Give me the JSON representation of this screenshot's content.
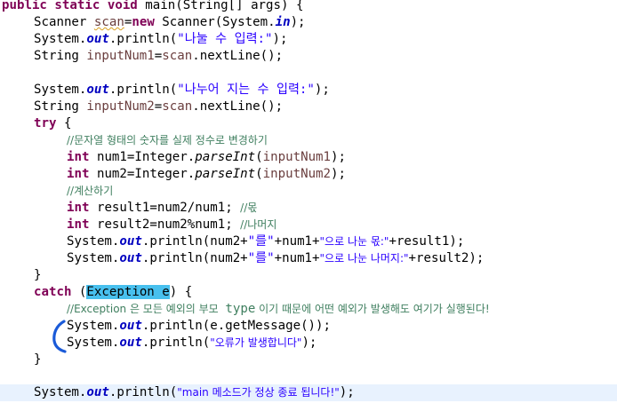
{
  "editor": {
    "l1": {
      "kw1": "public",
      "kw2": "static",
      "kw3": "void",
      "rest": " main(String[] args) {"
    },
    "l2": {
      "a": "Scanner ",
      "scan": "scan",
      "b": "=",
      "kw": "new",
      "c": " Scanner(System.",
      "in": "in",
      "d": ");"
    },
    "l3": {
      "a": "System.",
      "out": "out",
      "b": ".println(",
      "s": "\"나눌 수 입력:\"",
      "c": ");"
    },
    "l4": {
      "a": "String ",
      "v": "inputNum1",
      "b": "=",
      "scan": "scan",
      "c": ".nextLine();"
    },
    "l6": {
      "a": "System.",
      "out": "out",
      "b": ".println(",
      "s": "\"나누어 지는 수 입력:\"",
      "c": ");"
    },
    "l7": {
      "a": "String ",
      "v": "inputNum2",
      "b": "=",
      "scan": "scan",
      "c": ".nextLine();"
    },
    "l8": {
      "kw": "try",
      "b": " {"
    },
    "l9": {
      "cm": "//문자열 형태의 숫자를 실제 정수로 변경하기"
    },
    "l10": {
      "kw": "int",
      "a": " num1=Integer.",
      "m": "parseInt",
      "b": "(",
      "v": "inputNum1",
      "c": ");"
    },
    "l11": {
      "kw": "int",
      "a": " num2=Integer.",
      "m": "parseInt",
      "b": "(",
      "v": "inputNum2",
      "c": ");"
    },
    "l12": {
      "cm": "//계산하기"
    },
    "l13": {
      "kw": "int",
      "a": " result1=num2/num1; ",
      "cm": "//몫"
    },
    "l14": {
      "kw": "int",
      "a": " result2=num2%num1; ",
      "cm": "//나머지"
    },
    "l15": {
      "a": "System.",
      "out": "out",
      "b": ".println(num2+",
      "s1": "\"를\"",
      "c": "+num1+",
      "s2": "\"으로 나눈 몫:\"",
      "d": "+result1);"
    },
    "l16": {
      "a": "System.",
      "out": "out",
      "b": ".println(num2+",
      "s1": "\"를\"",
      "c": "+num1+",
      "s2": "\"으로 나눈 나머지:\"",
      "d": "+result2);"
    },
    "l17": {
      "a": "}"
    },
    "l18": {
      "kw": "catch",
      "a": " (",
      "sel": "Exception e",
      "b": ") {"
    },
    "l19": {
      "cm1": "//Exception 은 모든 예외의 부모  ",
      "cmw": "type",
      "cm2": " 이기 때문에 어떤 예외가 발생해도 여기가 실행된다!"
    },
    "l20": {
      "a": "System.",
      "out": "out",
      "b": ".println(e.getMessage());"
    },
    "l21": {
      "a": "System.",
      "out": "out",
      "b": ".println(",
      "s": "\"오류가 발생합니다\"",
      "c": ");"
    },
    "l22": {
      "a": "}"
    },
    "l24": {
      "a": "System.",
      "out": "out",
      "b": ".println(",
      "s": "\"main 메소드가 정상 종료 됩니다!\"",
      "c": ");"
    }
  },
  "colors": {
    "keyword": "#7f0055",
    "field": "#0000c0",
    "string": "#2a00ff",
    "comment": "#3f7f5f",
    "selection": "#48c0ee",
    "current_line": "#e8f2fe",
    "annotation": "#1a5ad8"
  }
}
